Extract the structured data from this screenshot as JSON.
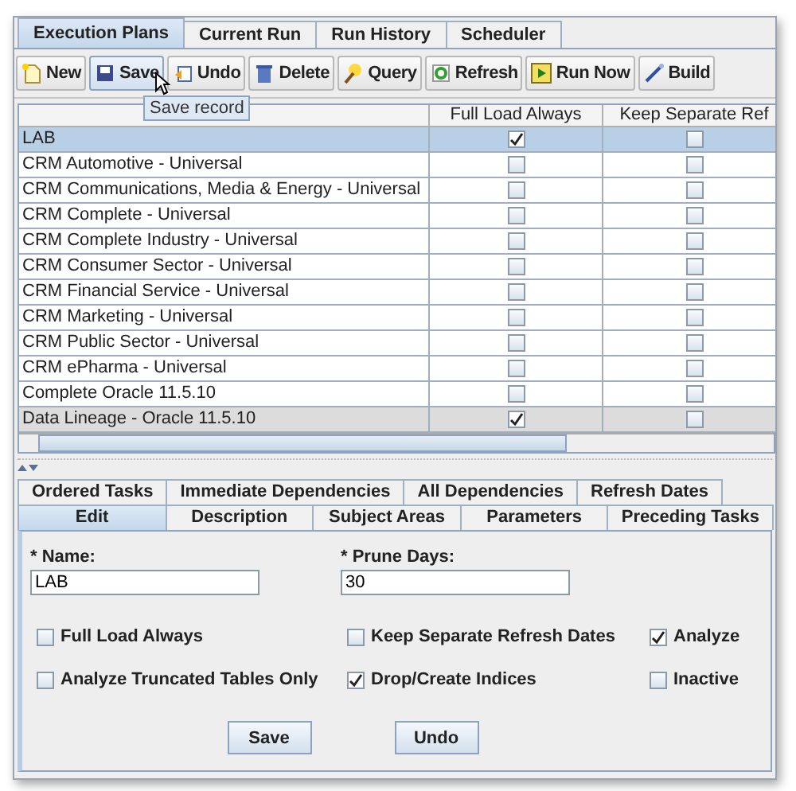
{
  "top_tabs": [
    {
      "label": "Execution Plans",
      "selected": true
    },
    {
      "label": "Current Run",
      "selected": false
    },
    {
      "label": "Run History",
      "selected": false
    },
    {
      "label": "Scheduler",
      "selected": false
    }
  ],
  "toolbar": [
    {
      "label": "New",
      "kind": "new"
    },
    {
      "label": "Save",
      "kind": "save"
    },
    {
      "label": "Undo",
      "kind": "undo"
    },
    {
      "label": "Delete",
      "kind": "delete"
    },
    {
      "label": "Query",
      "kind": "query"
    },
    {
      "label": "Refresh",
      "kind": "refresh"
    },
    {
      "label": "Run Now",
      "kind": "run"
    },
    {
      "label": "Build",
      "kind": "build"
    }
  ],
  "tooltip": "Save record",
  "table": {
    "columns": [
      {
        "label": "Full Load Always"
      },
      {
        "label": "Keep Separate Ref"
      }
    ],
    "rows": [
      {
        "name": "LAB",
        "full_load_always": true,
        "keep_separate": false,
        "selected": true,
        "shaded": false
      },
      {
        "name": "CRM Automotive - Universal",
        "full_load_always": false,
        "keep_separate": false,
        "selected": false,
        "shaded": false
      },
      {
        "name": "CRM Communications, Media & Energy - Universal",
        "full_load_always": false,
        "keep_separate": false,
        "selected": false,
        "shaded": false
      },
      {
        "name": "CRM Complete - Universal",
        "full_load_always": false,
        "keep_separate": false,
        "selected": false,
        "shaded": false
      },
      {
        "name": "CRM Complete Industry - Universal",
        "full_load_always": false,
        "keep_separate": false,
        "selected": false,
        "shaded": false
      },
      {
        "name": "CRM Consumer Sector - Universal",
        "full_load_always": false,
        "keep_separate": false,
        "selected": false,
        "shaded": false
      },
      {
        "name": "CRM Financial Service - Universal",
        "full_load_always": false,
        "keep_separate": false,
        "selected": false,
        "shaded": false
      },
      {
        "name": "CRM Marketing - Universal",
        "full_load_always": false,
        "keep_separate": false,
        "selected": false,
        "shaded": false
      },
      {
        "name": "CRM Public Sector - Universal",
        "full_load_always": false,
        "keep_separate": false,
        "selected": false,
        "shaded": false
      },
      {
        "name": "CRM ePharma - Universal",
        "full_load_always": false,
        "keep_separate": false,
        "selected": false,
        "shaded": false
      },
      {
        "name": "Complete Oracle 11.5.10",
        "full_load_always": false,
        "keep_separate": false,
        "selected": false,
        "shaded": false
      },
      {
        "name": "Data Lineage - Oracle 11.5.10",
        "full_load_always": true,
        "keep_separate": false,
        "selected": false,
        "shaded": true
      }
    ]
  },
  "detail_tabs": [
    [
      {
        "label": "Ordered Tasks",
        "selected": false
      },
      {
        "label": "Immediate Dependencies",
        "selected": false
      },
      {
        "label": "All Dependencies",
        "selected": false
      },
      {
        "label": "Refresh Dates",
        "selected": false
      }
    ],
    [
      {
        "label": "Edit",
        "selected": true
      },
      {
        "label": "Description",
        "selected": false
      },
      {
        "label": "Subject Areas",
        "selected": false
      },
      {
        "label": "Parameters",
        "selected": false
      },
      {
        "label": "Preceding Tasks",
        "selected": false
      }
    ]
  ],
  "fields": [
    {
      "label": "* Name:",
      "value": "LAB"
    },
    {
      "label": "* Prune Days:",
      "value": "30"
    }
  ],
  "checkboxes": [
    {
      "label": "Full Load Always",
      "checked": false
    },
    {
      "label": "Keep Separate Refresh Dates",
      "checked": false
    },
    {
      "label": "Analyze",
      "checked": true
    },
    {
      "label": "Analyze Truncated Tables Only",
      "checked": false
    },
    {
      "label": "Drop/Create Indices",
      "checked": true
    },
    {
      "label": "Inactive",
      "checked": false
    }
  ],
  "buttons": [
    "Save",
    "Undo"
  ]
}
